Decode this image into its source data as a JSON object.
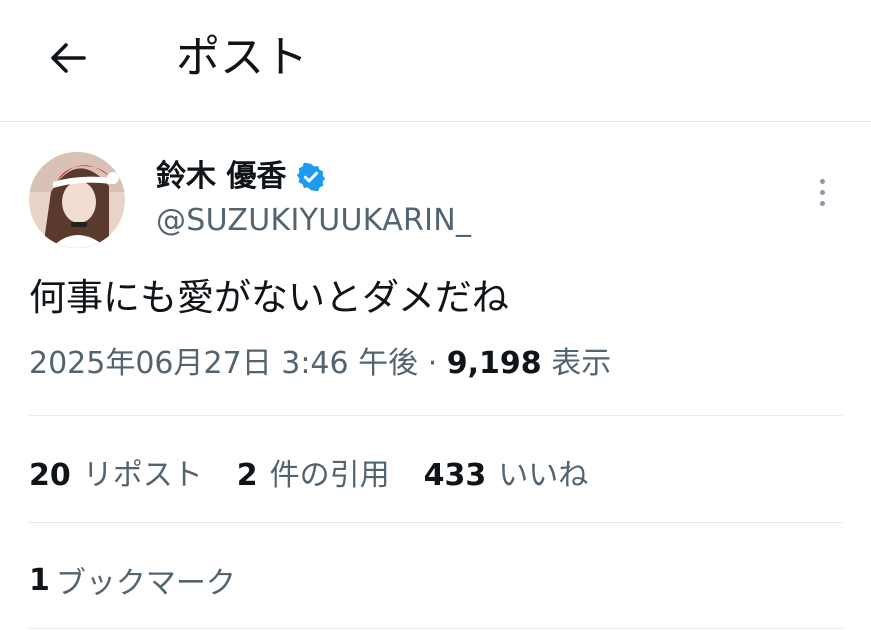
{
  "header": {
    "back_icon": "arrow-left-icon",
    "title": "ポスト"
  },
  "author": {
    "display_name": "鈴木 優香",
    "verified": true,
    "verified_color": "#1d9bf0",
    "handle": "@SUZUKIYUUKARIN_"
  },
  "post": {
    "text": "何事にも愛がないとダメだね",
    "timestamp": "2025年06月27日 3:46 午後",
    "separator": "·",
    "views_count": "9,198",
    "views_label": "表示"
  },
  "stats": {
    "reposts": {
      "count": "20",
      "label": "リポスト"
    },
    "quotes": {
      "count": "2",
      "label": "件の引用"
    },
    "likes": {
      "count": "433",
      "label": "いいね"
    }
  },
  "bookmarks": {
    "count": "1",
    "label": "ブックマーク"
  },
  "colors": {
    "text_primary": "#0f1419",
    "text_secondary": "#536471",
    "divider": "#e6e9eb",
    "accent": "#1d9bf0"
  }
}
